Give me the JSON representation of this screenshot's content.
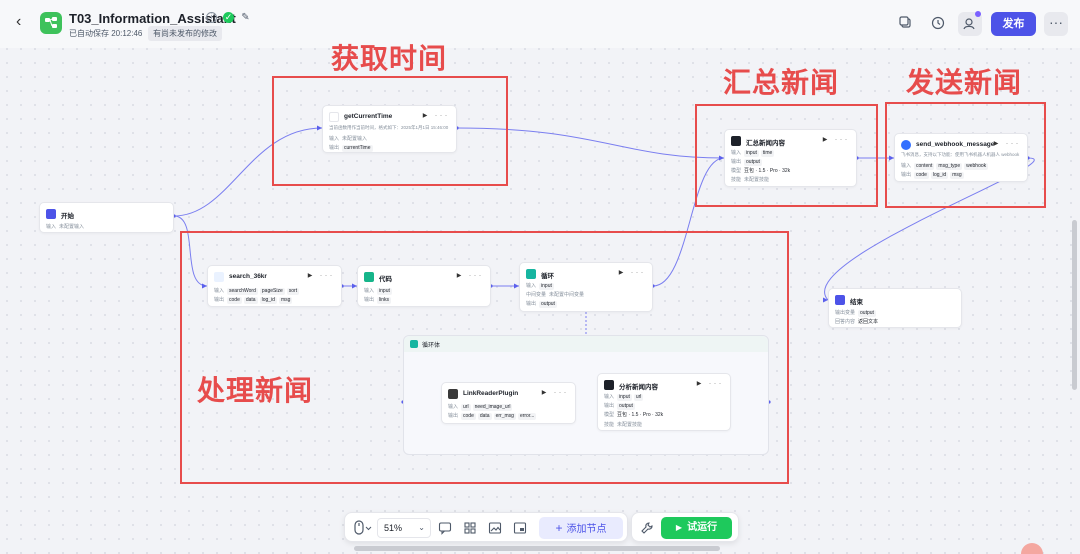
{
  "app": {
    "title": "T03_Information_Assistant",
    "autosave": "已自动保存 20:12:46",
    "unpublished": "有尚未发布的修改",
    "publish_label": "发布"
  },
  "annotations": {
    "get_time": "获取时间",
    "summarize": "汇总新闻",
    "send": "发送新闻",
    "process": "处理新闻"
  },
  "nodes": {
    "start": {
      "title": "开始",
      "input_key": "输入",
      "input_val": "未配置输入"
    },
    "get_time": {
      "title": "getCurrentTime",
      "desc": "当前函数用作当前时间，格式如下：2025年1月1日 15:46:00",
      "input_key": "输入",
      "input_val": "未配置输入",
      "output_key": "输出",
      "output_val": "currentTime"
    },
    "summary": {
      "title": "汇总新闻内容",
      "input_key": "输入",
      "inputs": [
        "input",
        "time"
      ],
      "output_key": "输出",
      "output_val": "output",
      "model_key": "模型",
      "model_val": "豆包 · 1.5 · Pro · 32k",
      "skill_key": "技能",
      "skill_val": "未配置技能"
    },
    "webhook": {
      "title": "send_webhook_message",
      "desc": "飞书消息，支持以下功能：使用飞书机器人机器人 webhook",
      "input_key": "输入",
      "inputs": [
        "content",
        "msg_type",
        "webhook"
      ],
      "output_key": "输出",
      "outputs": [
        "code",
        "log_id",
        "msg"
      ]
    },
    "search": {
      "title": "search_36kr",
      "input_key": "输入",
      "inputs": [
        "searchWord",
        "pageSize",
        "sort"
      ],
      "output_key": "输出",
      "outputs": [
        "code",
        "data",
        "log_id",
        "msg"
      ]
    },
    "code": {
      "title": "代码",
      "input_key": "输入",
      "input_val": "input",
      "output_key": "输出",
      "output_val": "links"
    },
    "loop": {
      "title": "循环",
      "input_key": "输入",
      "input_val": "input",
      "var_key": "中间变量",
      "var_val": "未配置中间变量",
      "output_key": "输出",
      "output_val": "output"
    },
    "loop_body": {
      "title": "循环体"
    },
    "link_reader": {
      "title": "LinkReaderPlugin",
      "input_key": "输入",
      "inputs": [
        "url",
        "need_image_url"
      ],
      "output_key": "输出",
      "outputs": [
        "code",
        "data",
        "err_msg",
        "error..."
      ]
    },
    "analyze": {
      "title": "分析新闻内容",
      "input_key": "输入",
      "inputs": [
        "input",
        "url"
      ],
      "output_key": "输出",
      "output_val": "output",
      "model_key": "模型",
      "model_val": "豆包 · 1.5 · Pro · 32k",
      "skill_key": "技能",
      "skill_val": "未配置技能"
    },
    "end": {
      "title": "结束",
      "output_key": "输出变量",
      "output_val": "output",
      "answer_key": "回答内容",
      "answer_val": "返回文本"
    }
  },
  "toolbar": {
    "zoom": "51%",
    "add_node": "添加节点",
    "run": "试运行"
  },
  "colors": {
    "accent": "#4d53e8",
    "annotation": "#e74c4c",
    "run": "#1ec95c",
    "edge": "#6b6ff0"
  }
}
